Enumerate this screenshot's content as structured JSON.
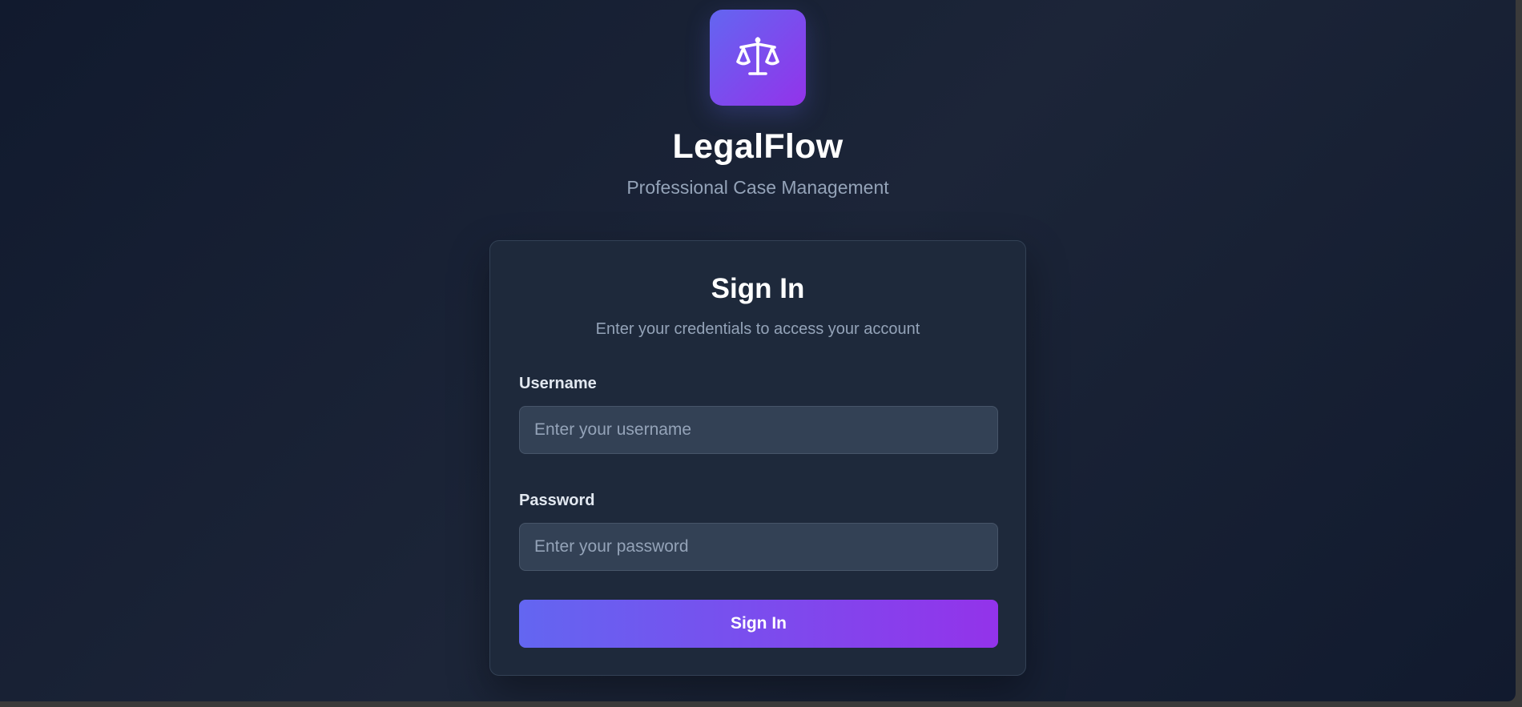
{
  "brand": {
    "icon": "scales-of-justice-icon",
    "name": "LegalFlow",
    "tagline": "Professional Case Management",
    "gradient_from": "#6366f1",
    "gradient_to": "#9333ea"
  },
  "login_card": {
    "title": "Sign In",
    "subtitle": "Enter your credentials to access your account",
    "username": {
      "label": "Username",
      "value": "",
      "placeholder": "Enter your username"
    },
    "password": {
      "label": "Password",
      "value": "",
      "placeholder": "Enter your password"
    },
    "submit_label": "Sign In"
  },
  "colors": {
    "background": "#111a2e",
    "card": "#1e293b",
    "input": "#334155",
    "muted_text": "#94a3b8"
  }
}
